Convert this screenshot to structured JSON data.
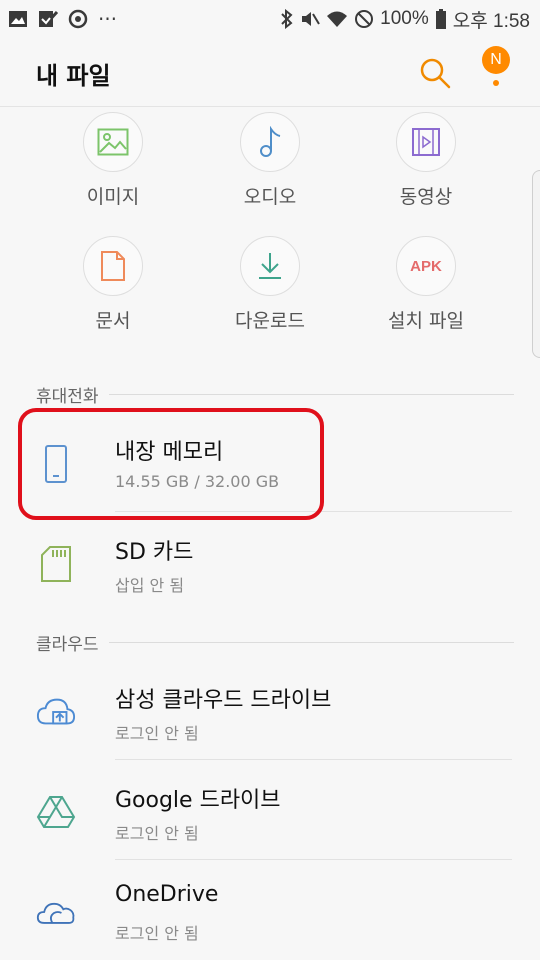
{
  "status_bar": {
    "battery": "100%",
    "time": "오후 1:58",
    "left_icons": [
      "image-icon",
      "checkmark-icon",
      "sync-icon",
      "more-icon"
    ],
    "more": "⋯"
  },
  "appbar": {
    "title": "내 파일",
    "account_initial": "N"
  },
  "categories": [
    {
      "label": "이미지",
      "icon": "image-icon",
      "color": "#7cc46a"
    },
    {
      "label": "오디오",
      "icon": "music-note-icon",
      "color": "#4f8ec9"
    },
    {
      "label": "동영상",
      "icon": "video-icon",
      "color": "#8c6bd0"
    },
    {
      "label": "문서",
      "icon": "document-icon",
      "color": "#ef8a5a"
    },
    {
      "label": "다운로드",
      "icon": "download-icon",
      "color": "#3ea48c"
    },
    {
      "label": "설치 파일",
      "icon_text": "APK",
      "color": "#e46b6b"
    }
  ],
  "sections": {
    "phone": "휴대전화",
    "cloud": "클라우드"
  },
  "storage_items": [
    {
      "title": "내장 메모리",
      "subtitle": "14.55 GB / 32.00 GB",
      "icon": "phone-icon"
    },
    {
      "title": "SD 카드",
      "subtitle": "삽입 안 됨",
      "icon": "sd-card-icon"
    }
  ],
  "cloud_items": [
    {
      "title": "삼성 클라우드 드라이브",
      "subtitle": "로그인 안 됨",
      "icon": "samsung-cloud-icon"
    },
    {
      "title": "Google 드라이브",
      "subtitle": "로그인 안 됨",
      "icon": "google-drive-icon"
    },
    {
      "title": "OneDrive",
      "subtitle": "로그인 안 됨",
      "icon": "onedrive-icon"
    }
  ],
  "colors": {
    "accent": "#ff8a00",
    "highlight": "#e0101b"
  }
}
